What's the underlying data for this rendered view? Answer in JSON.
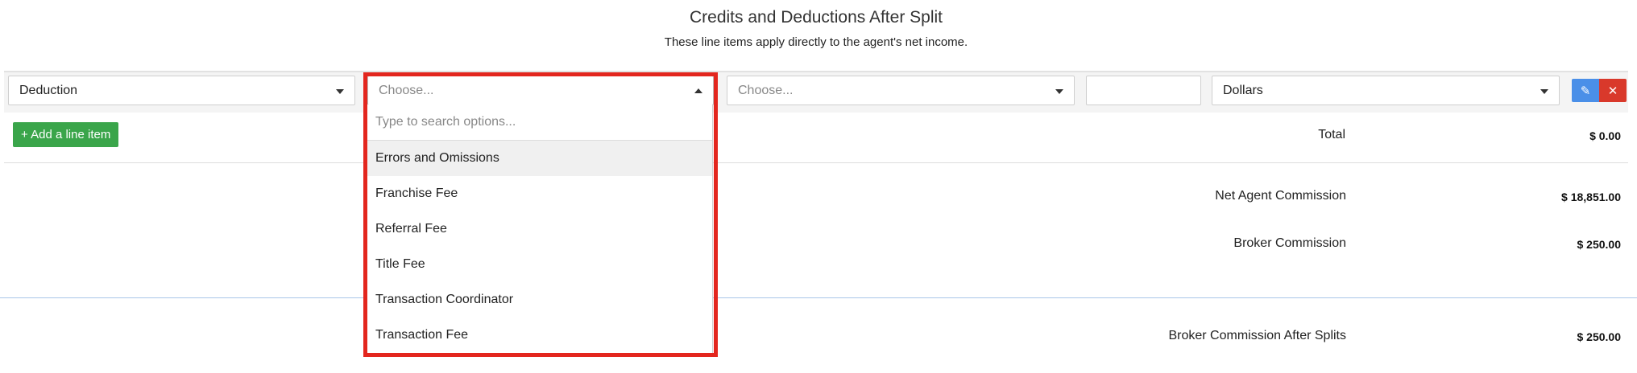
{
  "header": {
    "title": "Credits and Deductions After Split",
    "subtitle": "These line items apply directly to the agent's net income."
  },
  "line_item": {
    "type_select": "Deduction",
    "category_select": {
      "placeholder": "Choose..."
    },
    "sub_select": {
      "placeholder": "Choose..."
    },
    "amount_input": {
      "value": ""
    },
    "unit_select": "Dollars"
  },
  "dropdown": {
    "search_placeholder": "Type to search options...",
    "options": [
      "Errors and Omissions",
      "Franchise Fee",
      "Referral Fee",
      "Title Fee",
      "Transaction Coordinator",
      "Transaction Fee"
    ],
    "highlighted_index": 0
  },
  "actions": {
    "add_label": "+ Add a line item",
    "edit_icon": "pencil-icon",
    "remove_icon": "close-icon"
  },
  "totals": {
    "total_label": "Total",
    "total_value": "$ 0.00",
    "net_agent_label": "Net Agent Commission",
    "net_agent_value": "$ 18,851.00",
    "broker_label": "Broker Commission",
    "broker_value": "$ 250.00",
    "broker_after_label": "Broker Commission After Splits",
    "broker_after_value": "$ 250.00"
  },
  "colors": {
    "add_button": "#3aa54a",
    "edit_button": "#4a8fe8",
    "remove_button": "#d9392b",
    "highlight_border": "#e3261e"
  }
}
